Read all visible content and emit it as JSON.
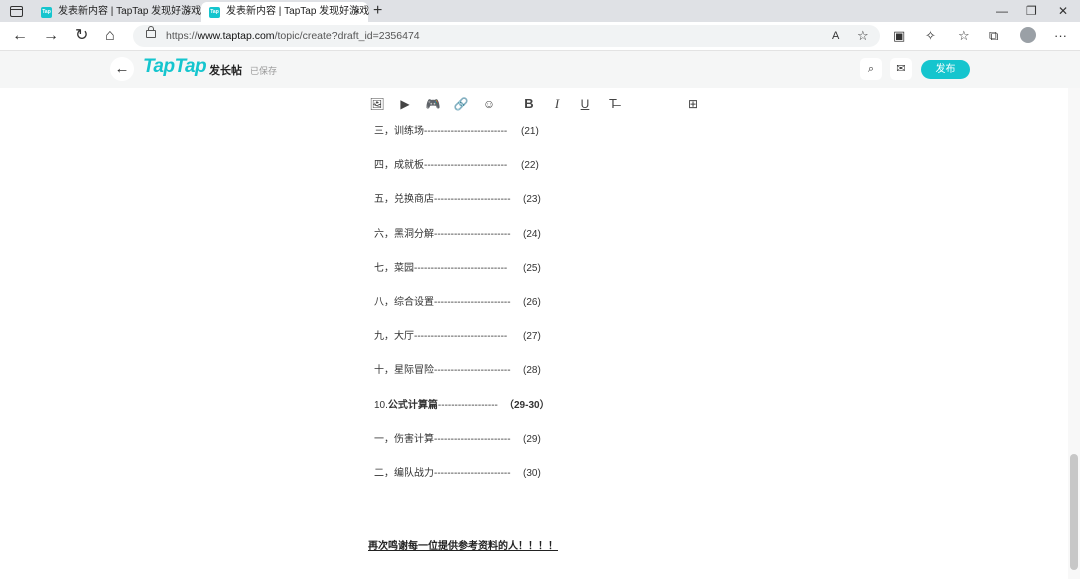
{
  "browser": {
    "tabs": [
      {
        "favicon": "Tap",
        "title": "发表新内容 | TapTap 发现好游戏",
        "close": "×"
      },
      {
        "favicon": "Tap",
        "title": "发表新内容 | TapTap 发现好游戏",
        "close": "×"
      }
    ],
    "new_tab": "+",
    "window_controls": {
      "minimize": "—",
      "restore": "❐",
      "close": "✕"
    },
    "url_prefix": "https://",
    "url_host": "www.taptap.com",
    "url_path": "/topic/create?draft_id=2356474",
    "nav": {
      "back": "←",
      "forward": "→",
      "reload": "↻",
      "home": "⌂"
    },
    "right_icons": {
      "read_aloud": "A",
      "favorite": "☆",
      "split": "▣",
      "extensions": "✧",
      "favorites": "☆",
      "collections": "⧉",
      "menu": "···"
    }
  },
  "app": {
    "back": "←",
    "logo": "TapTap",
    "title": "发长帖",
    "status": "已保存",
    "publish_label": "发布",
    "icons": {
      "preview": "⌕",
      "mail": "✉"
    }
  },
  "toolbar": {
    "image": "🖼",
    "video": "▶",
    "game": "🎮",
    "link": "🔗",
    "emoji": "☺",
    "bold": "B",
    "italic": "I",
    "underline": "U",
    "clear_format": "T̶",
    "insert_block": "⊞"
  },
  "toc": [
    {
      "label": "三，训练场-------------------------",
      "page": "(21)"
    },
    {
      "label": "四，成就板-------------------------",
      "page": "(22)"
    },
    {
      "label": "五，兑换商店-----------------------",
      "page": "(23)"
    },
    {
      "label": "六，黑洞分解-----------------------",
      "page": "(24)"
    },
    {
      "label": "七，菜园----------------------------",
      "page": "(25)"
    },
    {
      "label": "八，综合设置-----------------------",
      "page": "(26)"
    },
    {
      "label": "九，大厅----------------------------",
      "page": "(27)"
    },
    {
      "label": "十，星际冒险-----------------------",
      "page": "(28)"
    },
    {
      "prefix": "10.",
      "bold_label": "公式计算篇",
      "dashes": "------------------",
      "page": "（29-30）"
    },
    {
      "label": "一，伤害计算-----------------------",
      "page": "(29)"
    },
    {
      "label": "二，编队战力-----------------------",
      "page": "(30)"
    }
  ],
  "footer_text": "再次鸣谢每一位提供参考资料的人！！！！"
}
